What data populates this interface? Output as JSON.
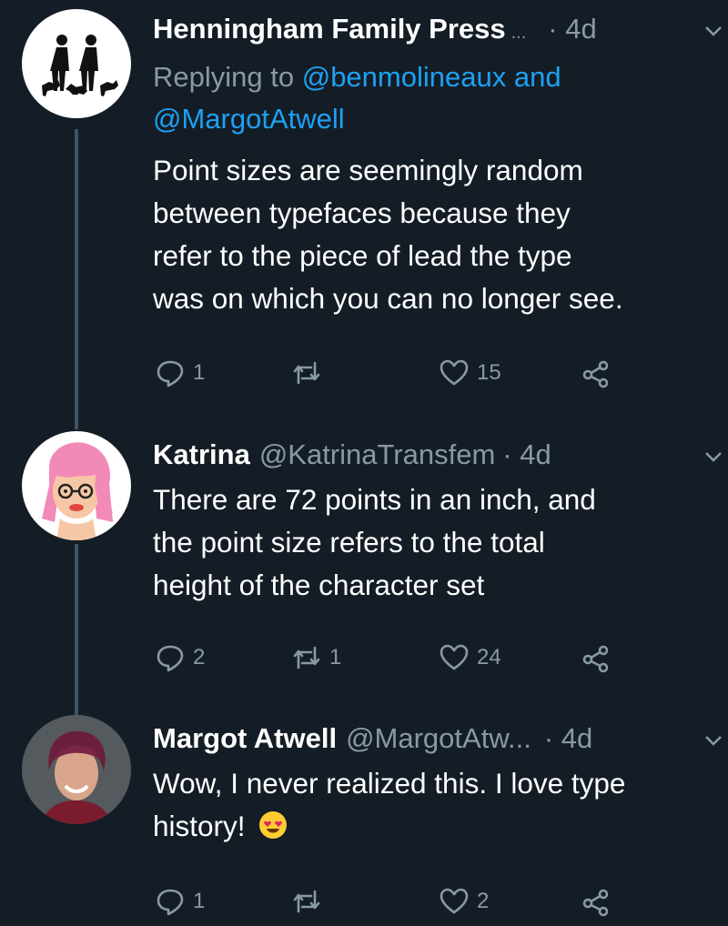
{
  "tweets": [
    {
      "name": "Henningham Family Press",
      "handle": "",
      "ellipsis": "...",
      "time": "· 4d",
      "reply_prefix": "Replying to ",
      "reply_mention_1": "@benmolineaux",
      "reply_and": " and",
      "reply_mention_2": "@MargotAtwell",
      "text_lines": [
        "Point sizes are seemingly random",
        "between typefaces because they",
        "refer to the piece of lead the type",
        "was on which you can no longer see."
      ],
      "replies": "1",
      "retweets": "",
      "likes": "15"
    },
    {
      "name": "Katrina",
      "handle": "@KatrinaTransfem",
      "time": "· 4d",
      "text_lines": [
        "There are 72 points in an inch, and",
        "the point size refers to the total",
        "height of the character set"
      ],
      "replies": "2",
      "retweets": "1",
      "likes": "24"
    },
    {
      "name": "Margot Atwell",
      "handle": "@MargotAtw...",
      "time": "· 4d",
      "text_lines": [
        "Wow, I never realized this. I love type",
        "history!"
      ],
      "emoji": "heart-eyes-emoji",
      "replies": "1",
      "retweets": "",
      "likes": "2"
    }
  ],
  "colors": {
    "background": "#141d26",
    "secondary_text": "#8899a6",
    "link": "#1da1f2",
    "thread_line": "#3d5466"
  }
}
